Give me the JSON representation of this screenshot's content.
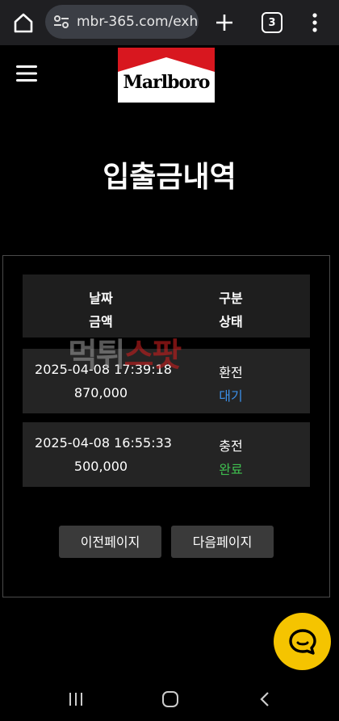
{
  "browser": {
    "url": "mbr-365.com/exh",
    "tab_count": "3"
  },
  "site": {
    "logo_text": "Marlboro",
    "page_title": "입출금내역"
  },
  "table": {
    "headers": {
      "col1_line1": "날짜",
      "col1_line2": "금액",
      "col2_line1": "구분",
      "col2_line2": "상태"
    },
    "rows": [
      {
        "datetime": "2025-04-08 17:39:18",
        "amount": "870,000",
        "type": "환전",
        "status": "대기",
        "status_color": "#3b8fe8"
      },
      {
        "datetime": "2025-04-08 16:55:33",
        "amount": "500,000",
        "type": "충전",
        "status": "완료",
        "status_color": "#3fbf4f"
      }
    ]
  },
  "watermark": {
    "part1": "먹튀",
    "part2": "스팟"
  },
  "pagination": {
    "prev_label": "이전페이지",
    "next_label": "다음페이지"
  },
  "colors": {
    "logo_red": "#d8171f",
    "chat_yellow": "#f5c400"
  },
  "icons": [
    "home-icon",
    "site-settings-icon",
    "plus-icon",
    "tabs-icon",
    "more-vert-icon",
    "hamburger-icon",
    "chat-icon",
    "nav-recent-icon",
    "nav-home-icon",
    "nav-back-icon"
  ]
}
